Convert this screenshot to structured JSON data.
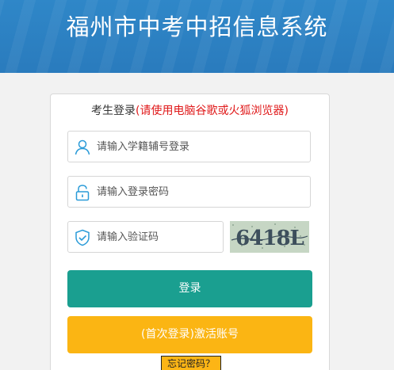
{
  "header": {
    "title": "福州市中考中招信息系统"
  },
  "login": {
    "title": "考生登录",
    "hint": "(请使用电脑谷歌或火狐浏览器)",
    "username_placeholder": "请输入学籍辅号登录",
    "password_placeholder": "请输入登录密码",
    "captcha_placeholder": "请输入验证码",
    "captcha_text": "6418L",
    "login_button": "登录",
    "activate_button": "(首次登录)激活账号",
    "forgot_link": "忘记密码？"
  },
  "colors": {
    "banner": "#2a7bbd",
    "hint_red": "#e0191a",
    "login_button": "#1a9f90",
    "activate_button": "#fbb513",
    "icon": "#2a9bd8"
  },
  "icons": {
    "user": "user-icon",
    "password": "lock-icon",
    "captcha": "shield-check-icon"
  }
}
